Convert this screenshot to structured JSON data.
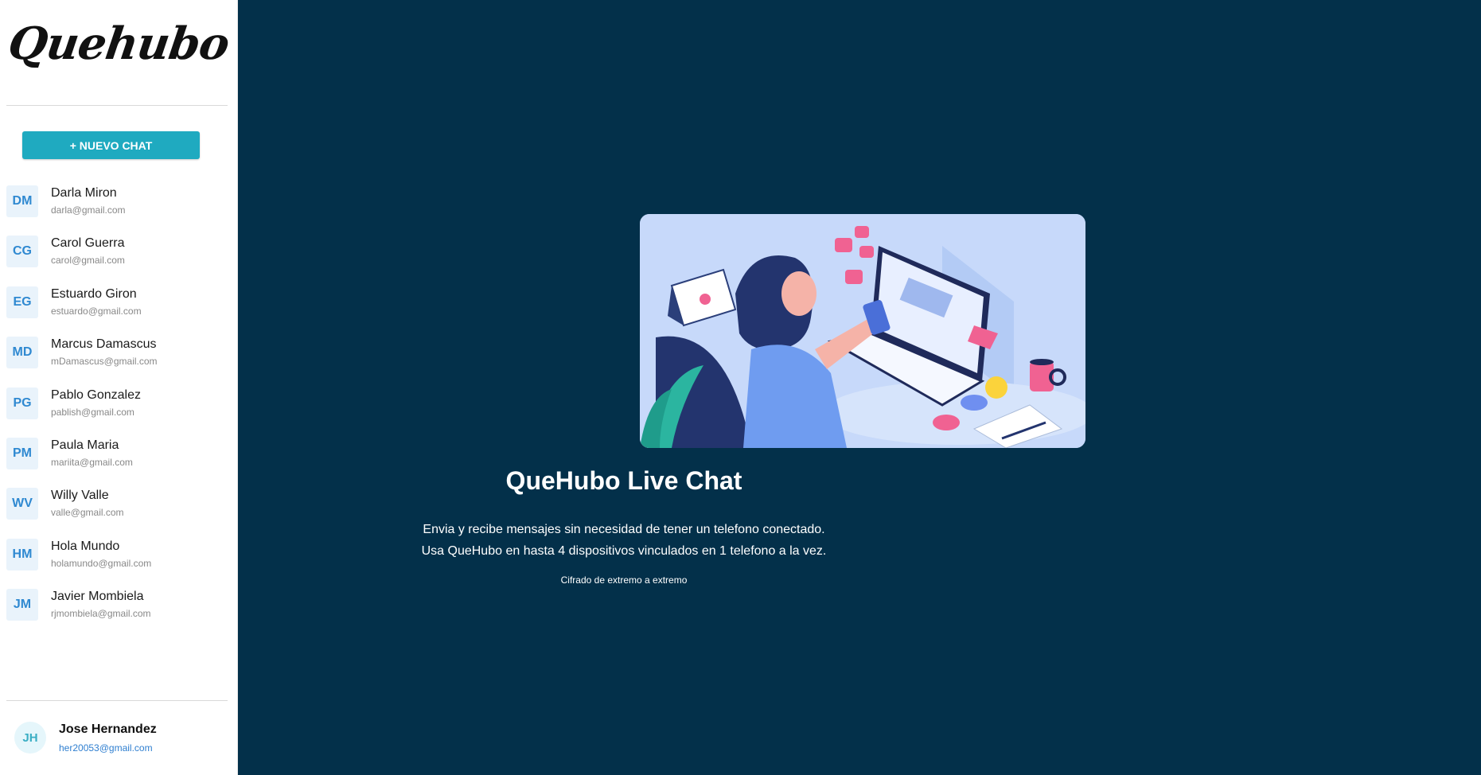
{
  "app": {
    "logo_text": "Quehubo"
  },
  "sidebar": {
    "new_chat_label": "+ NUEVO CHAT",
    "contacts": [
      {
        "initials": "DM",
        "name": "Darla Miron",
        "email": "darla@gmail.com"
      },
      {
        "initials": "CG",
        "name": "Carol Guerra",
        "email": "carol@gmail.com"
      },
      {
        "initials": "EG",
        "name": "Estuardo Giron",
        "email": "estuardo@gmail.com"
      },
      {
        "initials": "MD",
        "name": "Marcus Damascus",
        "email": "mDamascus@gmail.com"
      },
      {
        "initials": "PG",
        "name": "Pablo Gonzalez",
        "email": "pablish@gmail.com"
      },
      {
        "initials": "PM",
        "name": "Paula Maria",
        "email": "mariita@gmail.com"
      },
      {
        "initials": "WV",
        "name": "Willy Valle",
        "email": "valle@gmail.com"
      },
      {
        "initials": "HM",
        "name": "Hola Mundo",
        "email": "holamundo@gmail.com"
      },
      {
        "initials": "JM",
        "name": "Javier Mombiela",
        "email": "rjmombiela@gmail.com"
      }
    ],
    "current_user": {
      "initials": "JH",
      "name": "Jose Hernandez",
      "email": "her20053@gmail.com"
    }
  },
  "main": {
    "title": "QueHubo Live Chat",
    "line1": "Envia y recibe mensajes sin necesidad de tener un telefono conectado.",
    "line2": "Usa QueHubo en hasta 4 dispositivos vinculados en 1 telefono a la vez.",
    "footnote": "Cifrado de extremo a extremo"
  },
  "colors": {
    "background": "#03304a",
    "accent": "#1faac0",
    "avatar_text": "#2f89d1"
  }
}
